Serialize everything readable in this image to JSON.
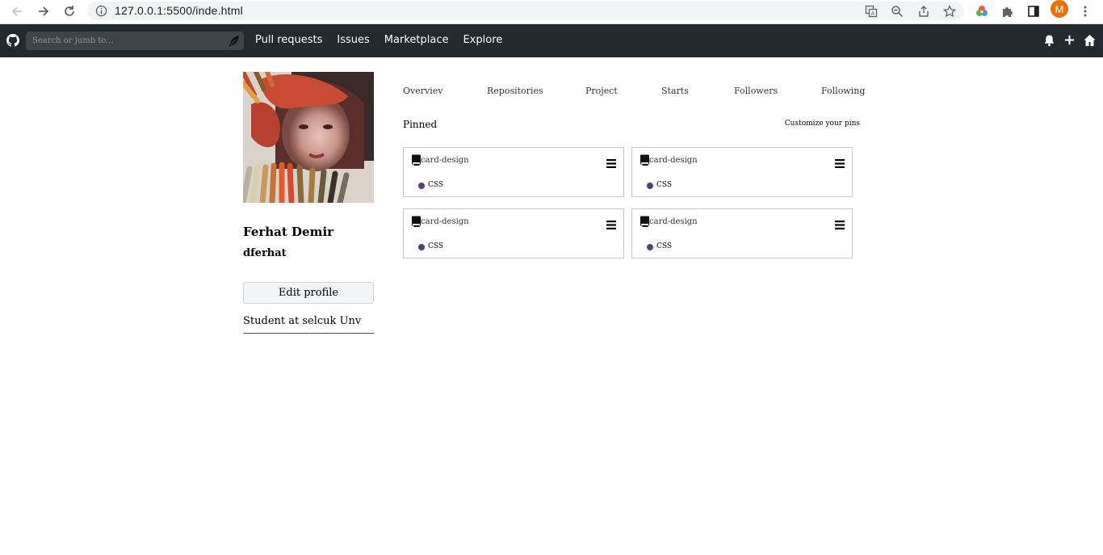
{
  "browser": {
    "url": "127.0.0.1:5500/inde.html",
    "profile_initial": "M",
    "profile_color": "#e8710a"
  },
  "header": {
    "search_placeholder": "Search or jumb to...",
    "nav": [
      "Pull requests",
      "Issues",
      "Marketplace",
      "Explore"
    ],
    "bg_color": "#24292e"
  },
  "profile": {
    "full_name": "Ferhat Demir",
    "username": "dferhat",
    "edit_label": "Edit profile",
    "bio": "Student at selcuk Unv"
  },
  "tabs": [
    "Overviev",
    "Repositories",
    "Project",
    "Starts",
    "Followers",
    "Following"
  ],
  "pinned": {
    "title": "Pinned",
    "customize_label": "Customize your pins",
    "cards": [
      {
        "name": "card-design",
        "language": "CSS",
        "language_color": "#563d7c"
      },
      {
        "name": "card-design",
        "language": "CSS",
        "language_color": "#563d7c"
      },
      {
        "name": "card-design",
        "language": "CSS",
        "language_color": "#563d7c"
      },
      {
        "name": "card-design",
        "language": "CSS",
        "language_color": "#563d7c"
      }
    ]
  }
}
